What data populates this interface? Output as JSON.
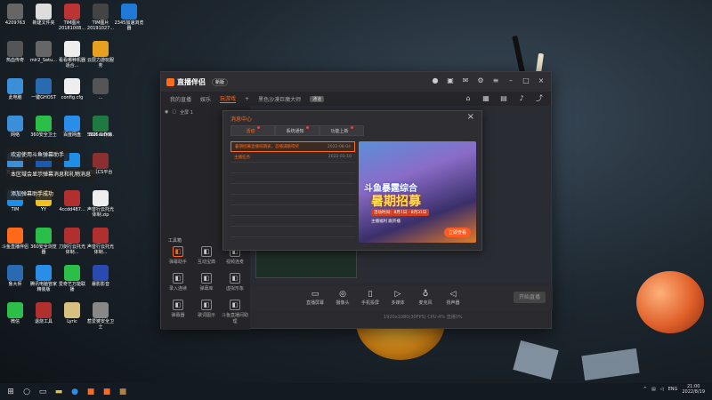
{
  "desktop_icons": [
    {
      "label": "4209763",
      "icon": "cat-icon",
      "color": "#666"
    },
    {
      "label": "新建文件夹",
      "icon": "file-icon",
      "color": "#ddd"
    },
    {
      "label": "TIM图片 20181008...",
      "icon": "photo-icon",
      "color": "#b33"
    },
    {
      "label": "TIM图片 20191027...",
      "icon": "photo-icon",
      "color": "#444"
    },
    {
      "label": "2345加速浏览器",
      "icon": "browser-icon",
      "color": "#1e7ad6"
    },
    {
      "label": "热血传奇",
      "icon": "game-icon",
      "color": "#555"
    },
    {
      "label": "mir2_Setu...",
      "icon": "game-icon",
      "color": "#666"
    },
    {
      "label": "看看哪种机器适合...",
      "icon": "doc-icon",
      "color": "#eee"
    },
    {
      "label": "云层力游玩服务",
      "icon": "app-icon",
      "color": "#e8a020"
    },
    {
      "label": "此电脑",
      "icon": "computer-icon",
      "color": "#3b8fd8"
    },
    {
      "label": "一键GHOST",
      "icon": "ghost-icon",
      "color": "#2a6ab0"
    },
    {
      "label": "config.cfg",
      "icon": "doc-icon",
      "color": "#eee"
    },
    {
      "label": "...",
      "icon": "doc-icon",
      "color": "#555"
    },
    {
      "label": "网络",
      "icon": "network-icon",
      "color": "#3b8fd8"
    },
    {
      "label": "360安全卫士",
      "icon": "shield-icon",
      "color": "#2bbf4a"
    },
    {
      "label": "百度网盘",
      "icon": "cloud-icon",
      "color": "#2a8ee8"
    },
    {
      "label": "5535ea0d...",
      "icon": "photo-icon",
      "color": "#777"
    },
    {
      "label": "SSX 工作簿",
      "icon": "excel-icon",
      "color": "#1e7a40"
    },
    {
      "label": "宽带连接",
      "icon": "network-icon",
      "color": "#3b8fd8"
    },
    {
      "label": "暴雪战网",
      "icon": "game-icon",
      "color": "#1a5ab0"
    },
    {
      "label": "酷狗音乐",
      "icon": "music-icon",
      "color": "#1e8ee8"
    },
    {
      "label": "暗黑CS平台",
      "icon": "game-icon",
      "color": "#8a3030"
    },
    {
      "label": "TIM",
      "icon": "tim-icon",
      "color": "#1e8ee8"
    },
    {
      "label": "YY",
      "icon": "yy-icon",
      "color": "#f0c020"
    },
    {
      "label": "4ccdd487...",
      "icon": "photo-icon",
      "color": "#b03030"
    },
    {
      "label": "声音行云托光体制.zip",
      "icon": "zip-icon",
      "color": "#eee"
    },
    {
      "label": "斗鱼直播伴侣",
      "icon": "douyu-icon",
      "color": "#ff6a1a"
    },
    {
      "label": "360安全浏览器",
      "icon": "browser-icon",
      "color": "#2bbf4a"
    },
    {
      "label": "刀剑行云托光体制...",
      "icon": "doc-icon",
      "color": "#b03030"
    },
    {
      "label": "声音行云托光体制...",
      "icon": "doc-icon",
      "color": "#b03030"
    },
    {
      "label": "鲁大师",
      "icon": "lu-icon",
      "color": "#2a6ab0"
    },
    {
      "label": "腾讯电脑管家精装版",
      "icon": "guard-icon",
      "color": "#2a8ee8"
    },
    {
      "label": "爱奇艺万能联播",
      "icon": "video-icon",
      "color": "#2bbf4a"
    },
    {
      "label": "暴影影音",
      "icon": "player-icon",
      "color": "#2a4ab0"
    },
    {
      "label": "微信",
      "icon": "wechat-icon",
      "color": "#2bbf4a"
    },
    {
      "label": "退烧工具",
      "icon": "tool-icon",
      "color": "#b03030"
    },
    {
      "label": "Lyric",
      "icon": "doc-icon",
      "color": "#d8c080"
    },
    {
      "label": "惹爱婆安全卫士",
      "icon": "doc-icon",
      "color": "#888"
    }
  ],
  "tooltips": {
    "line1": "欢迎使用斗鱼弹幕助手",
    "line2": "本区域会显示弹幕消息和礼物消息",
    "line3": "添加弹幕助手成功"
  },
  "window": {
    "title": "直播伴侣",
    "version": "新版",
    "tabs": [
      {
        "label": "我的直播",
        "active": false
      },
      {
        "label": "娱乐",
        "active": false
      },
      {
        "label": "玩游戏",
        "active": true
      },
      {
        "label": "+",
        "active": false
      },
      {
        "label": "黑色沙漠巨魔大师",
        "active": false
      },
      {
        "label": "通道",
        "active": false,
        "badge": true
      }
    ],
    "scene_label": "全屏 1",
    "tools_title": "工具箱",
    "tools": [
      {
        "label": "弹幕助手",
        "icon": "danmu-icon",
        "on": true
      },
      {
        "label": "互动宝典",
        "icon": "user-icon",
        "on": false
      },
      {
        "label": "视频连麦",
        "icon": "video-icon",
        "on": false
      },
      {
        "label": "录入连续",
        "icon": "record-icon",
        "on": false
      },
      {
        "label": "弹幕库",
        "icon": "lib-icon",
        "on": false
      },
      {
        "label": "虚拟形象",
        "icon": "avatar-icon",
        "on": false
      },
      {
        "label": "弹幕器",
        "icon": "box-icon",
        "on": false
      },
      {
        "label": "歌词图示",
        "icon": "music-icon",
        "on": false
      },
      {
        "label": "斗鱼直播间助理",
        "icon": "assist-icon",
        "on": false
      }
    ],
    "bottom_buttons": [
      {
        "label": "直播屏幕",
        "icon": "screen-icon"
      },
      {
        "label": "摄像头",
        "icon": "camera-icon"
      },
      {
        "label": "手机投屏",
        "icon": "phone-icon"
      },
      {
        "label": "多媒体",
        "icon": "media-icon"
      },
      {
        "label": "麦克风",
        "icon": "mic-icon"
      },
      {
        "label": "扬声器",
        "icon": "speaker-icon"
      }
    ],
    "start_live": "开始直播",
    "status": "1920x1080(30FPS)  CPU:4%  直播0%"
  },
  "dialog": {
    "title": "消息中心",
    "tabs": [
      {
        "label": "活动",
        "active": true,
        "dot": true
      },
      {
        "label": "系统通知",
        "active": false,
        "dot": true
      },
      {
        "label": "功能上新",
        "active": false,
        "dot": true
      }
    ],
    "rows": [
      {
        "title": "暑期招募直播排期表，首播满额得奖",
        "date": "2022-08-04",
        "highlight": true
      },
      {
        "title": "主播任务",
        "date": "2022-03-10",
        "highlight": false
      }
    ],
    "banner": {
      "line1": "斗鱼暴霆综合",
      "line2": "暑期招募",
      "line3": "活动时间：8月1日 - 8月31日",
      "line4": "主播福利 跟开播",
      "button": "立即查看"
    }
  },
  "taskbar": {
    "time": "21:00",
    "date": "2022/8/19",
    "lang": "ENG"
  }
}
